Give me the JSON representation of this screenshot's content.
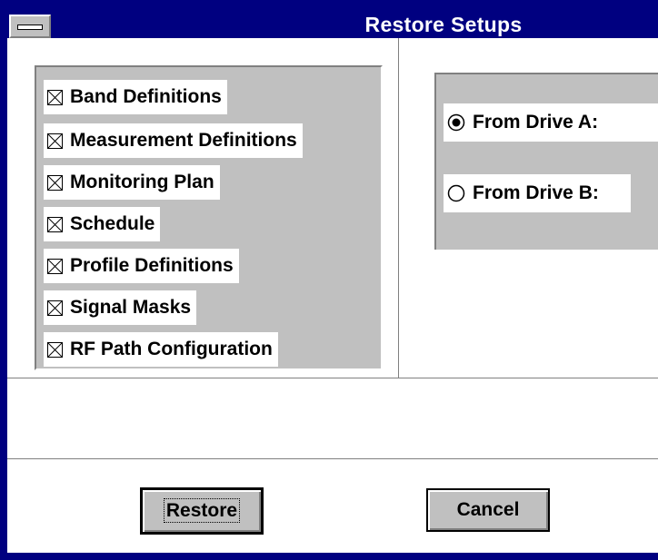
{
  "window": {
    "title": "Restore Setups"
  },
  "setups": {
    "items": [
      {
        "label": "Band Definitions",
        "checked": true
      },
      {
        "label": "Measurement Definitions",
        "checked": true
      },
      {
        "label": "Monitoring Plan",
        "checked": true
      },
      {
        "label": "Schedule",
        "checked": true
      },
      {
        "label": "Profile Definitions",
        "checked": true
      },
      {
        "label": "Signal Masks",
        "checked": true
      },
      {
        "label": "RF Path Configuration",
        "checked": true
      }
    ]
  },
  "source": {
    "options": [
      {
        "label": "From Drive A:",
        "selected": true
      },
      {
        "label": "From Drive B:",
        "selected": false
      }
    ]
  },
  "buttons": {
    "restore_label": "Restore",
    "cancel_label": "Cancel"
  },
  "colors": {
    "titlebar": "#000080",
    "face": "#c0c0c0",
    "shadow": "#808080",
    "highlight": "#ffffff"
  },
  "icons": {
    "checkbox": "checked-box-icon",
    "radio_on": "radio-selected-icon",
    "radio_off": "radio-unselected-icon",
    "system_menu": "system-menu-icon"
  }
}
